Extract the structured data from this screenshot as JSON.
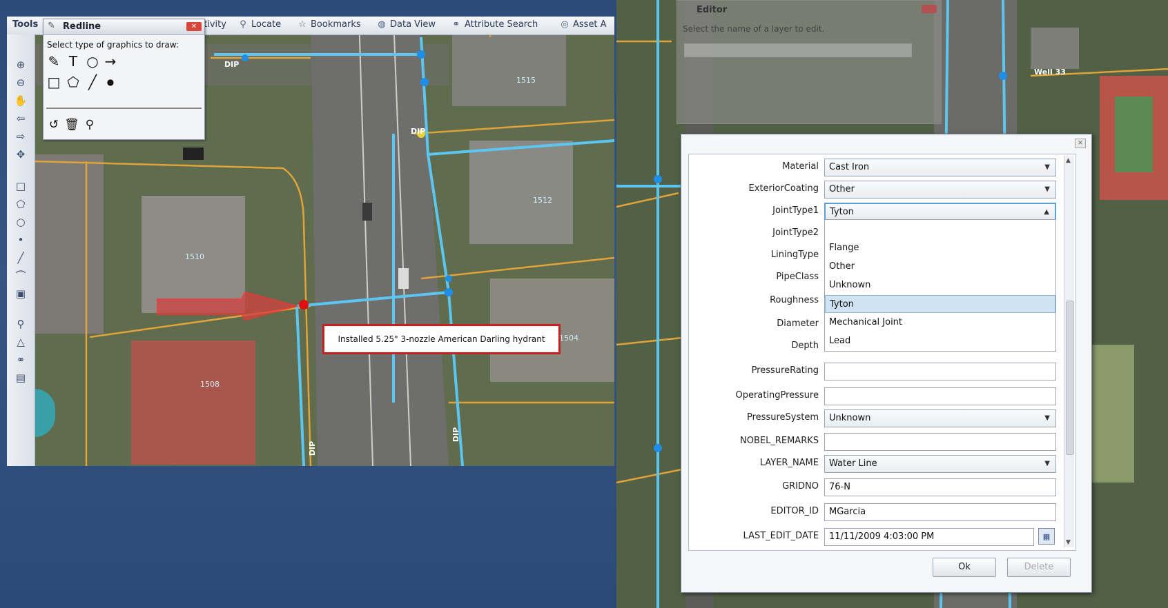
{
  "toolbar": {
    "tools_label": "Tools",
    "items": [
      {
        "label": "ctivity"
      },
      {
        "label": "Locate"
      },
      {
        "label": "Bookmarks"
      },
      {
        "label": "Data View"
      },
      {
        "label": "Attribute Search"
      },
      {
        "label": "Asset A"
      }
    ]
  },
  "redline": {
    "title": "Redline",
    "prompt": "Select type of graphics to draw:"
  },
  "map_left": {
    "callout": "Installed 5.25\" 3-nozzle American Darling hydrant",
    "pipe_labels": [
      "DIP",
      "DIP",
      "DIP",
      "DIP"
    ],
    "parcel_labels": [
      "1515",
      "1512",
      "1510",
      "1508",
      "1504"
    ]
  },
  "editor": {
    "title": "Editor",
    "message": "Select the name of a layer to edit."
  },
  "attributes": {
    "fields": [
      {
        "label": "Material",
        "value": "Cast Iron",
        "type": "combo"
      },
      {
        "label": "ExteriorCoating",
        "value": "Other",
        "type": "combo"
      },
      {
        "label": "JointType1",
        "value": "Tyton",
        "type": "combo"
      },
      {
        "label": "JointType2",
        "value": "",
        "type": "hidden"
      },
      {
        "label": "LiningType",
        "value": "",
        "type": "hidden"
      },
      {
        "label": "PipeClass",
        "value": "",
        "type": "hidden"
      },
      {
        "label": "Roughness",
        "value": "",
        "type": "hidden"
      },
      {
        "label": "Diameter",
        "value": "",
        "type": "hidden"
      },
      {
        "label": "Depth",
        "value": "",
        "type": "hidden"
      },
      {
        "label": "PressureRating",
        "value": "",
        "type": "text"
      },
      {
        "label": "OperatingPressure",
        "value": "",
        "type": "text"
      },
      {
        "label": "PressureSystem",
        "value": "Unknown",
        "type": "combo"
      },
      {
        "label": "NOBEL_REMARKS",
        "value": "",
        "type": "text"
      },
      {
        "label": "LAYER_NAME",
        "value": "Water Line",
        "type": "combo"
      },
      {
        "label": "GRIDNO",
        "value": "76-N",
        "type": "text"
      },
      {
        "label": "EDITOR_ID",
        "value": "MGarcia",
        "type": "text"
      },
      {
        "label": "LAST_EDIT_DATE",
        "value": "11/11/2009 4:03:00 PM",
        "type": "date"
      }
    ],
    "dropdown_options": [
      "Flange",
      "Other",
      "Unknown",
      "Tyton",
      "Mechanical Joint",
      "Lead"
    ],
    "dropdown_selected": "Tyton",
    "ok_label": "Ok",
    "delete_label": "Delete"
  },
  "map_right": {
    "labels": [
      "Well 33"
    ]
  },
  "colors": {
    "pipe": "#5cc6f0",
    "parcel": "#e0a43a",
    "callout_border": "#c82020",
    "selection": "#cfe3f3"
  }
}
